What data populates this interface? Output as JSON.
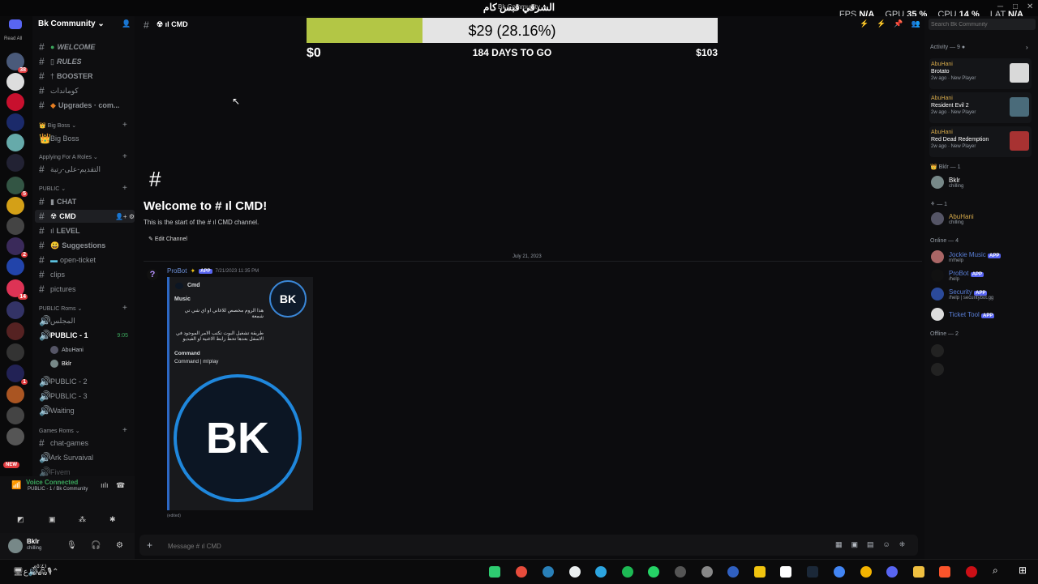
{
  "window": {
    "title": "الشرقي قبس كام",
    "overlay_title": "Bk Community"
  },
  "perf": {
    "fps_label": "FPS",
    "fps": "N/A",
    "gpu_label": "GPU",
    "gpu": "35 %",
    "cpu_label": "CPU",
    "cpu": "14 %",
    "lat_label": "LAT",
    "lat": "N/A"
  },
  "server": {
    "name": "Bk Community",
    "read_all": "Read All"
  },
  "channels": {
    "welcome": "WELCOME",
    "rules": "RULES",
    "booster": "BOOSTER",
    "commands": "كوماندات",
    "upgrades": "Upgrades · com...",
    "cat_bigboss": "Big Boss",
    "bigboss": "Big Boss",
    "cat_roles": "Applying For A Roles",
    "apply": "التقديم-على-رتبة",
    "cat_public": "PUBLIC",
    "chat": "CHAT",
    "cmd": "CMD",
    "level": "LEVEL",
    "suggestions": "Suggestions",
    "open_ticket": "open-ticket",
    "clips": "clips",
    "pictures": "pictures",
    "cat_public_rooms": "PUBLIC Roms",
    "majlis": "المجلس",
    "public1": "PUBLIC - 1",
    "public1_time": "9:05",
    "vc_user1": "AbuHani",
    "vc_user2": "Bklr",
    "public2": "PUBLIC - 2",
    "public3": "PUBLIC - 3",
    "waiting": "Waiting",
    "cat_games": "Games Roms",
    "chat_games": "chat-games",
    "ark": "Ark Survaival",
    "fivem": "Fivem"
  },
  "voice": {
    "status": "Voice Connected",
    "channel": "PUBLIC - 1 / Bk Community"
  },
  "user": {
    "name": "Bklr",
    "status": "chilling"
  },
  "header": {
    "channel": "CMD"
  },
  "goal": {
    "current": "$29 (28.16%)",
    "min": "$0",
    "days": "184 DAYS TO GO",
    "max": "$103",
    "progress": 0.2816
  },
  "welcome": {
    "title": "Welcome to # ıl CMD!",
    "sub": "This is the start of the # ıl CMD channel.",
    "edit": "Edit Channel"
  },
  "date_divider": "July 21, 2023",
  "message": {
    "author": "ProBot",
    "app": "APP",
    "time": "7/21/2023 11:35 PM",
    "embed_author": "Cmd",
    "embed_title": "Music",
    "line1": "هذا الروم مخصص للاغاني او اي شي تي شمعة",
    "line2": "طريقة تشغيل البوت تكتب الامر الموجود في الاسفل بعدها تحط رابط الاغنية او الفيديو",
    "field_name": "Command",
    "field_value": "Command | m!play",
    "thumb": "BK",
    "logo": "BK",
    "edited": "(edited)"
  },
  "composer": {
    "placeholder": "Message # ıl CMD"
  },
  "members": {
    "search_placeholder": "Search Bk Community",
    "activity_header": "Activity — 9",
    "activities": [
      {
        "name": "AbuHani",
        "game": "Brotato",
        "meta": "2w ago · New Player",
        "color": "#d9d9d9"
      },
      {
        "name": "AbuHani",
        "game": "Resident Evil 2",
        "meta": "2w ago · New Player",
        "color": "#4a6b7a"
      },
      {
        "name": "AbuHani",
        "game": "Red Dead Redemption",
        "meta": "2w ago · New Player",
        "color": "#a83232"
      }
    ],
    "bklr_header": "Bklr — 1",
    "bklr_name": "Bklr",
    "bklr_status": "chilling",
    "one_header": "— 1",
    "abuhani_name": "AbuHani",
    "abuhani_status": "chilling",
    "online_header": "Online — 4",
    "online": [
      {
        "name": "Jockie Music",
        "sub": "m!help",
        "app": "APP"
      },
      {
        "name": "ProBot",
        "sub": "/help",
        "app": "APP"
      },
      {
        "name": "Security",
        "sub": "/help | securitybot.gg",
        "app": "APP"
      },
      {
        "name": "Ticket Tool",
        "sub": "",
        "app": "APP"
      }
    ],
    "offline_header": "Offline — 2"
  },
  "taskbar": {
    "time": "٥:٤١م",
    "date": "٤/٧/١٠"
  }
}
